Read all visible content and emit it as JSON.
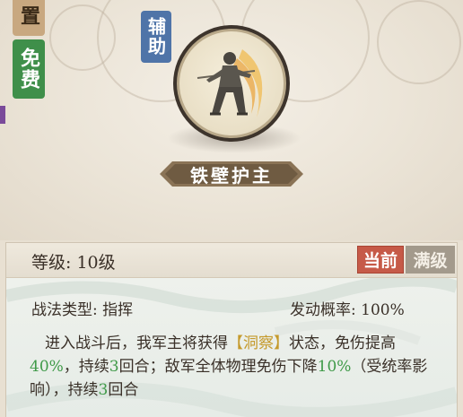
{
  "tags": {
    "position_char": "置",
    "free": "免费",
    "role": "辅助"
  },
  "skill": {
    "name": "铁壁护主"
  },
  "level": {
    "label": "等级:",
    "value": "10级"
  },
  "tabs": {
    "current": "当前",
    "max": "满级"
  },
  "tactic": {
    "type_label": "战法类型:",
    "type_value": "指挥",
    "rate_label": "发动概率:",
    "rate_value": "100%"
  },
  "effect": {
    "p1": "进入战斗后，我军主将获得",
    "status": "【洞察】",
    "p2": "状态，免伤提高",
    "val1": "40%",
    "p3": "，持续",
    "turns1": "3",
    "p4": "回合；敌军全体物理免伤下降",
    "val2": "10%",
    "p5": "（受统率影响），持续",
    "turns2": "3",
    "p6": "回合"
  },
  "colors": {
    "gold": "#c59a2c",
    "green": "#3f9a48",
    "current_tab": "#c65a48",
    "role_tag": "#4f74a8",
    "free_tag": "#3f8f4a"
  },
  "icons": {
    "portrait": "warrior-portrait-icon"
  }
}
